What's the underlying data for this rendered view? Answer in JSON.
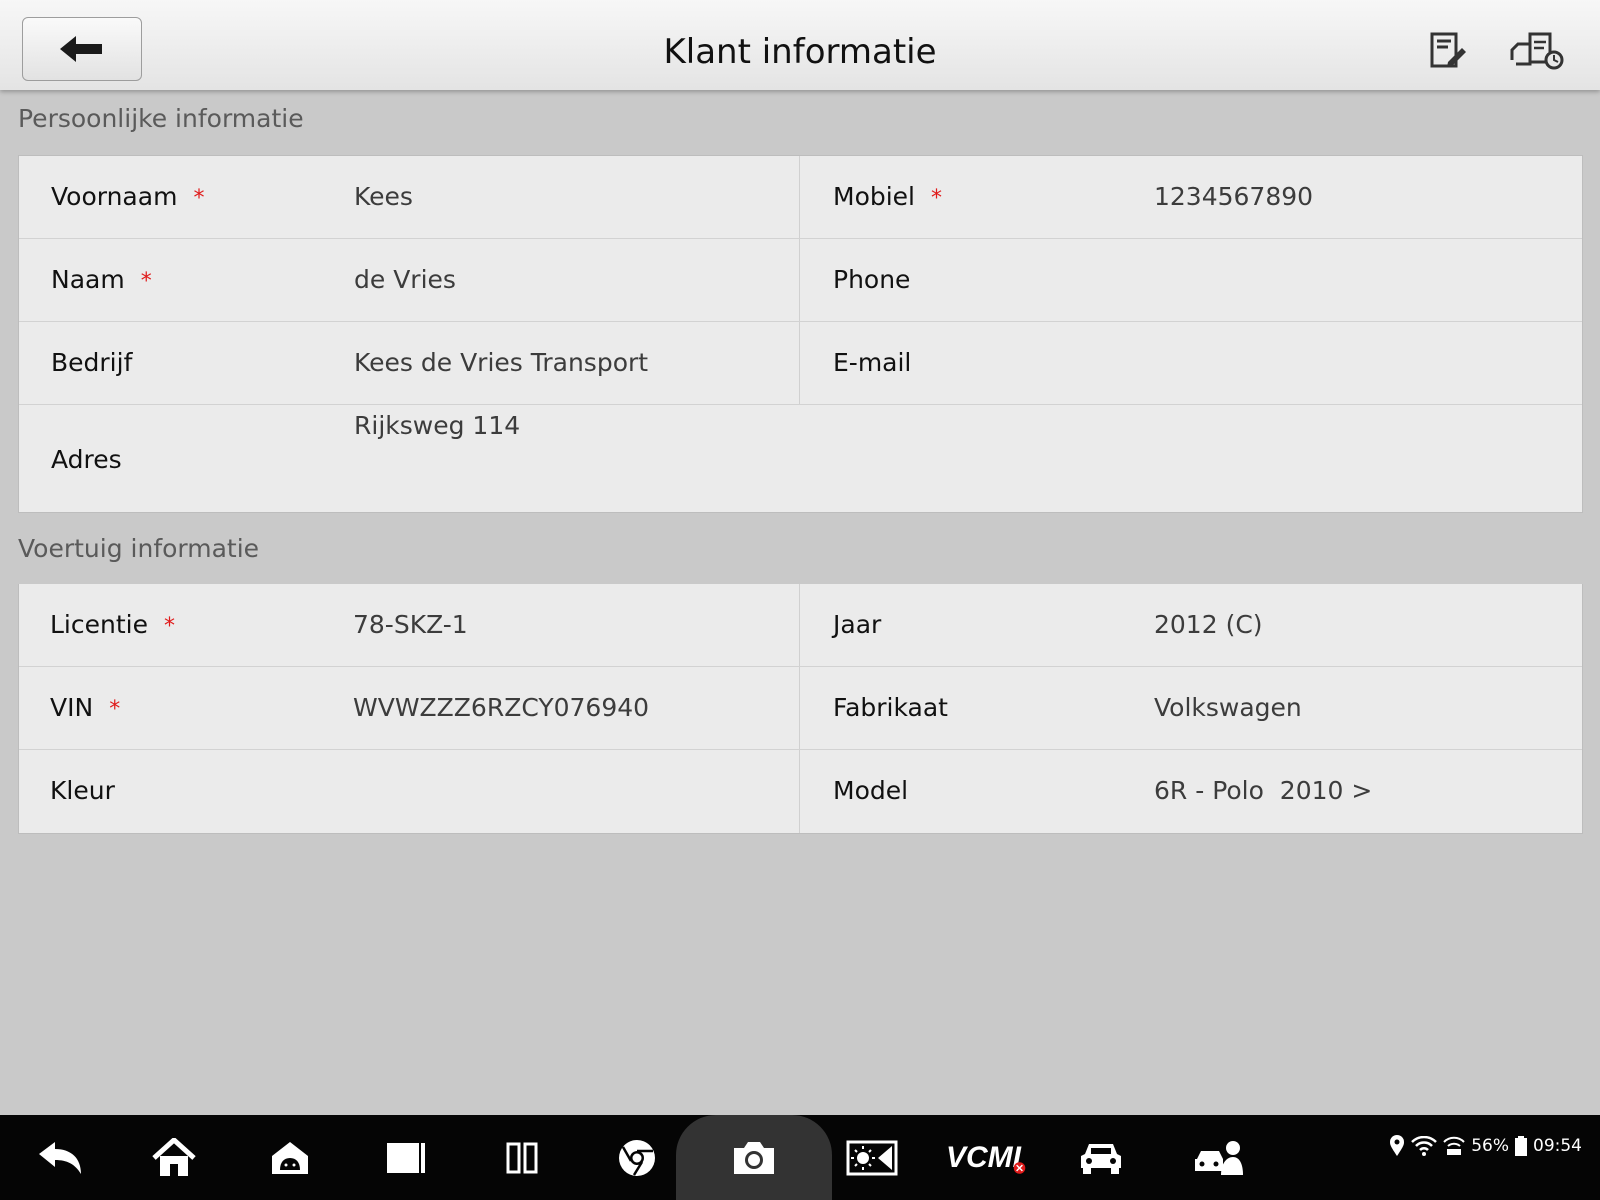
{
  "header": {
    "title": "Klant informatie",
    "back_icon": "back-arrow-icon",
    "edit_icon": "edit-document-icon",
    "history_icon": "vehicle-history-icon"
  },
  "personal": {
    "section_title": "Persoonlijke informatie",
    "required_mark": "*",
    "fields": {
      "voornaam": {
        "label": "Voornaam",
        "value": "Kees",
        "required": true
      },
      "mobiel": {
        "label": "Mobiel",
        "value": "1234567890",
        "required": true
      },
      "naam": {
        "label": "Naam",
        "value": "de Vries",
        "required": true
      },
      "phone": {
        "label": "Phone",
        "value": ""
      },
      "bedrijf": {
        "label": "Bedrijf",
        "value": "Kees de Vries Transport"
      },
      "email": {
        "label": "E-mail",
        "value": ""
      },
      "adres": {
        "label": "Adres",
        "value": "Rijksweg 114"
      }
    }
  },
  "vehicle": {
    "section_title": "Voertuig informatie",
    "required_mark": "*",
    "fields": {
      "licentie": {
        "label": "Licentie",
        "value": "78-SKZ-1",
        "required": true
      },
      "jaar": {
        "label": "Jaar",
        "value": "2012 (C)"
      },
      "vin": {
        "label": "VIN",
        "value": "WVWZZZ6RZCY076940",
        "required": true
      },
      "fabrikaat": {
        "label": "Fabrikaat",
        "value": "Volkswagen"
      },
      "kleur": {
        "label": "Kleur",
        "value": ""
      },
      "model": {
        "label": "Model",
        "value": "6R - Polo  2010 >"
      }
    }
  },
  "taskbar": {
    "vcm_label": "VCMI",
    "battery": "56%",
    "time": "09:54"
  },
  "colors": {
    "required": "#e01b1b",
    "background": "#c9c9c9",
    "panel": "#ebebeb"
  }
}
